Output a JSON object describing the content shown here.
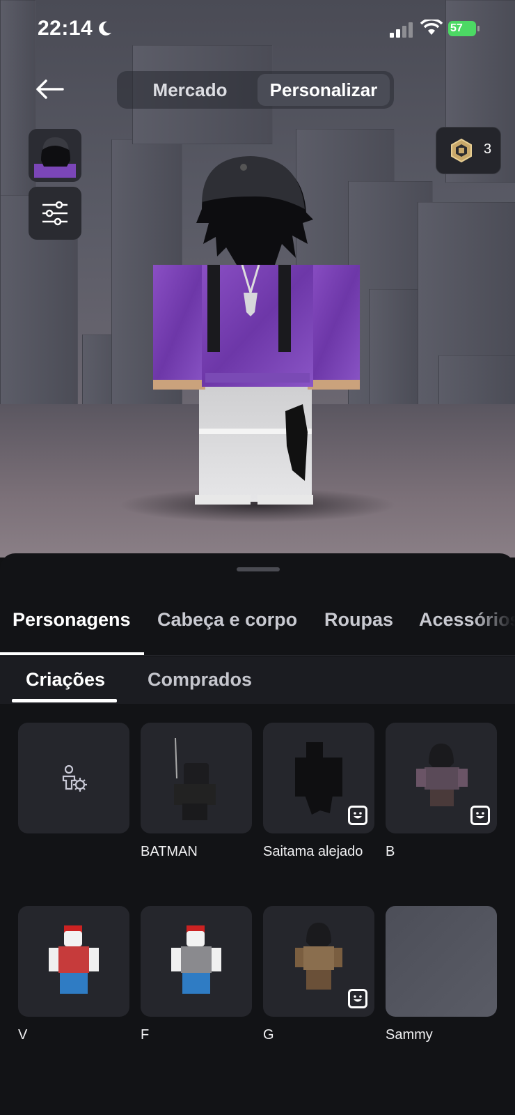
{
  "status_bar": {
    "time": "22:14",
    "battery": "57"
  },
  "header": {
    "tabs": [
      {
        "label": "Mercado",
        "active": false
      },
      {
        "label": "Personalizar",
        "active": true
      }
    ]
  },
  "currency": {
    "icon": "robux-icon",
    "amount": "3"
  },
  "category_tabs": [
    {
      "label": "Personagens",
      "active": true
    },
    {
      "label": "Cabeça e corpo",
      "active": false
    },
    {
      "label": "Roupas",
      "active": false
    },
    {
      "label": "Acessórios",
      "active": false
    }
  ],
  "sub_tabs": [
    {
      "label": "Criações",
      "active": true
    },
    {
      "label": "Comprados",
      "active": false
    }
  ],
  "characters": [
    {
      "label": "",
      "kind": "create"
    },
    {
      "label": "BATMAN",
      "kind": "batman"
    },
    {
      "label": "Saitama alejado",
      "kind": "silhouette",
      "emote": true
    },
    {
      "label": "B",
      "kind": "avatar-dark",
      "emote": true
    },
    {
      "label": "V",
      "kind": "noob-red"
    },
    {
      "label": "F",
      "kind": "noob-gray"
    },
    {
      "label": "G",
      "kind": "avatar-camo",
      "emote": true
    },
    {
      "label": "Sammy",
      "kind": "blank"
    }
  ],
  "colors": {
    "accent": "#4cd964",
    "sheet": "#121316",
    "card": "#25262c"
  }
}
